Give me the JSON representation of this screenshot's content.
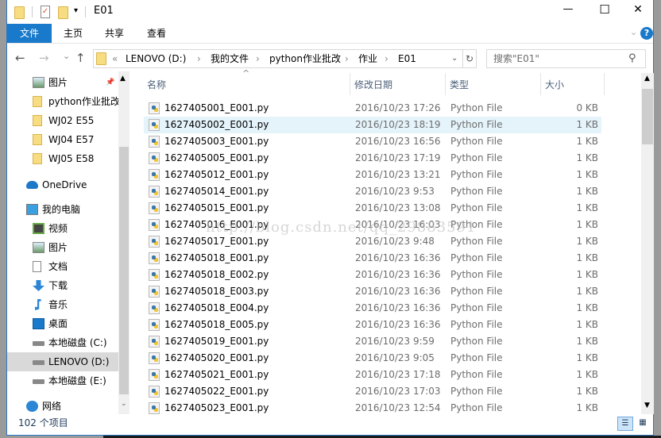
{
  "window": {
    "title": "E01",
    "minimize": "—",
    "maximize": "☐",
    "close": "✕",
    "help": "?"
  },
  "ribbon": {
    "tabs": [
      "文件",
      "主页",
      "共享",
      "查看"
    ]
  },
  "nav": {
    "back": "←",
    "forward": "→",
    "recent": "⌄",
    "up": "↑",
    "refresh": "↻"
  },
  "address": {
    "overflow": "«",
    "crumbs": [
      "LENOVO (D:)",
      "我的文件",
      "python作业批改",
      "作业",
      "E01"
    ]
  },
  "search": {
    "placeholder": "搜索\"E01\""
  },
  "sidebar": {
    "items": [
      {
        "label": "图片",
        "icon": "pictures-icon",
        "pinned": true
      },
      {
        "label": "python作业批改",
        "icon": "folder-icon"
      },
      {
        "label": "WJ02 E55",
        "icon": "folder-icon"
      },
      {
        "label": "WJ04 E57",
        "icon": "folder-icon"
      },
      {
        "label": "WJ05 E58",
        "icon": "folder-icon"
      },
      {
        "label": "OneDrive",
        "icon": "cloud-icon"
      },
      {
        "label": "我的电脑",
        "icon": "computer-icon"
      },
      {
        "label": "视频",
        "icon": "video-icon"
      },
      {
        "label": "图片",
        "icon": "pictures-icon"
      },
      {
        "label": "文档",
        "icon": "document-icon"
      },
      {
        "label": "下载",
        "icon": "download-icon"
      },
      {
        "label": "音乐",
        "icon": "music-icon"
      },
      {
        "label": "桌面",
        "icon": "desktop-icon"
      },
      {
        "label": "本地磁盘 (C:)",
        "icon": "drive-icon"
      },
      {
        "label": "LENOVO (D:)",
        "icon": "drive-icon",
        "selected": true
      },
      {
        "label": "本地磁盘 (E:)",
        "icon": "drive-icon"
      },
      {
        "label": "网络",
        "icon": "network-icon"
      }
    ]
  },
  "columns": {
    "name": "名称",
    "date": "修改日期",
    "type": "类型",
    "size": "大小"
  },
  "files": [
    {
      "name": "1627405001_E001.py",
      "date": "2016/10/23 17:26",
      "type": "Python File",
      "size": "0 KB"
    },
    {
      "name": "1627405002_E001.py",
      "date": "2016/10/23 18:19",
      "type": "Python File",
      "size": "1 KB",
      "hover": true
    },
    {
      "name": "1627405003_E001.py",
      "date": "2016/10/23 16:56",
      "type": "Python File",
      "size": "1 KB"
    },
    {
      "name": "1627405005_E001.py",
      "date": "2016/10/23 17:19",
      "type": "Python File",
      "size": "1 KB"
    },
    {
      "name": "1627405012_E001.py",
      "date": "2016/10/23 13:21",
      "type": "Python File",
      "size": "1 KB"
    },
    {
      "name": "1627405014_E001.py",
      "date": "2016/10/23 9:53",
      "type": "Python File",
      "size": "1 KB"
    },
    {
      "name": "1627405015_E001.py",
      "date": "2016/10/23 13:08",
      "type": "Python File",
      "size": "1 KB"
    },
    {
      "name": "1627405016_E001.py",
      "date": "2016/10/23 16:03",
      "type": "Python File",
      "size": "1 KB"
    },
    {
      "name": "1627405017_E001.py",
      "date": "2016/10/23 9:48",
      "type": "Python File",
      "size": "1 KB"
    },
    {
      "name": "1627405018_E001.py",
      "date": "2016/10/23 16:36",
      "type": "Python File",
      "size": "1 KB"
    },
    {
      "name": "1627405018_E002.py",
      "date": "2016/10/23 16:36",
      "type": "Python File",
      "size": "1 KB"
    },
    {
      "name": "1627405018_E003.py",
      "date": "2016/10/23 16:36",
      "type": "Python File",
      "size": "1 KB"
    },
    {
      "name": "1627405018_E004.py",
      "date": "2016/10/23 16:36",
      "type": "Python File",
      "size": "1 KB"
    },
    {
      "name": "1627405018_E005.py",
      "date": "2016/10/23 16:36",
      "type": "Python File",
      "size": "1 KB"
    },
    {
      "name": "1627405019_E001.py",
      "date": "2016/10/23 9:59",
      "type": "Python File",
      "size": "1 KB"
    },
    {
      "name": "1627405020_E001.py",
      "date": "2016/10/23 9:05",
      "type": "Python File",
      "size": "1 KB"
    },
    {
      "name": "1627405021_E001.py",
      "date": "2016/10/23 17:18",
      "type": "Python File",
      "size": "1 KB"
    },
    {
      "name": "1627405022_E001.py",
      "date": "2016/10/23 17:03",
      "type": "Python File",
      "size": "1 KB"
    },
    {
      "name": "1627405023_E001.py",
      "date": "2016/10/23 12:54",
      "type": "Python File",
      "size": "1 KB"
    }
  ],
  "status": {
    "count": "102 个项目"
  },
  "watermark": "http://blog.csdn.net/qq_29883591"
}
